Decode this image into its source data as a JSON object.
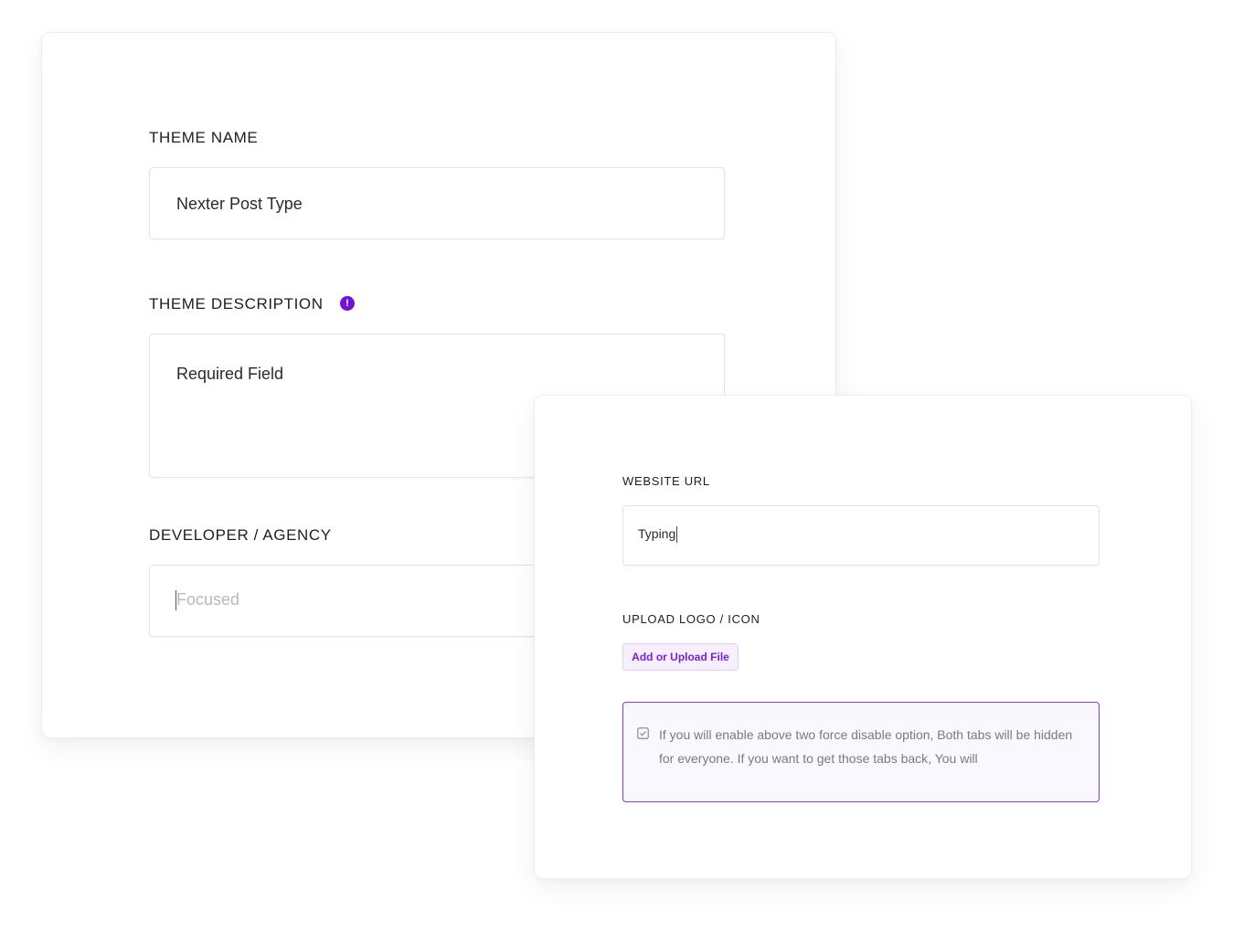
{
  "main_form": {
    "theme_name": {
      "label": "THEME NAME",
      "value": "Nexter Post Type"
    },
    "theme_description": {
      "label": "THEME DESCRIPTION",
      "info_icon": "exclamation-icon",
      "info_glyph": "!",
      "value": "Required Field"
    },
    "developer_agency": {
      "label": "DEVELOPER / AGENCY",
      "placeholder": "Focused"
    }
  },
  "secondary_form": {
    "website_url": {
      "label": "WEBSITE URL",
      "value": "Typing"
    },
    "upload_logo": {
      "label": "UPLOAD LOGO / ICON",
      "button_label": "Add or Upload File"
    },
    "notice": {
      "icon": "checkbox-icon",
      "text": "If you will enable above two force disable option, Both tabs will be hidden for everyone. If you want to get those tabs back, You will"
    }
  },
  "colors": {
    "accent": "#6d14d9",
    "notice_border": "#8f3ad9",
    "notice_bg": "#faf8ff",
    "button_bg": "#f6efff",
    "button_text": "#7a1fcf"
  }
}
